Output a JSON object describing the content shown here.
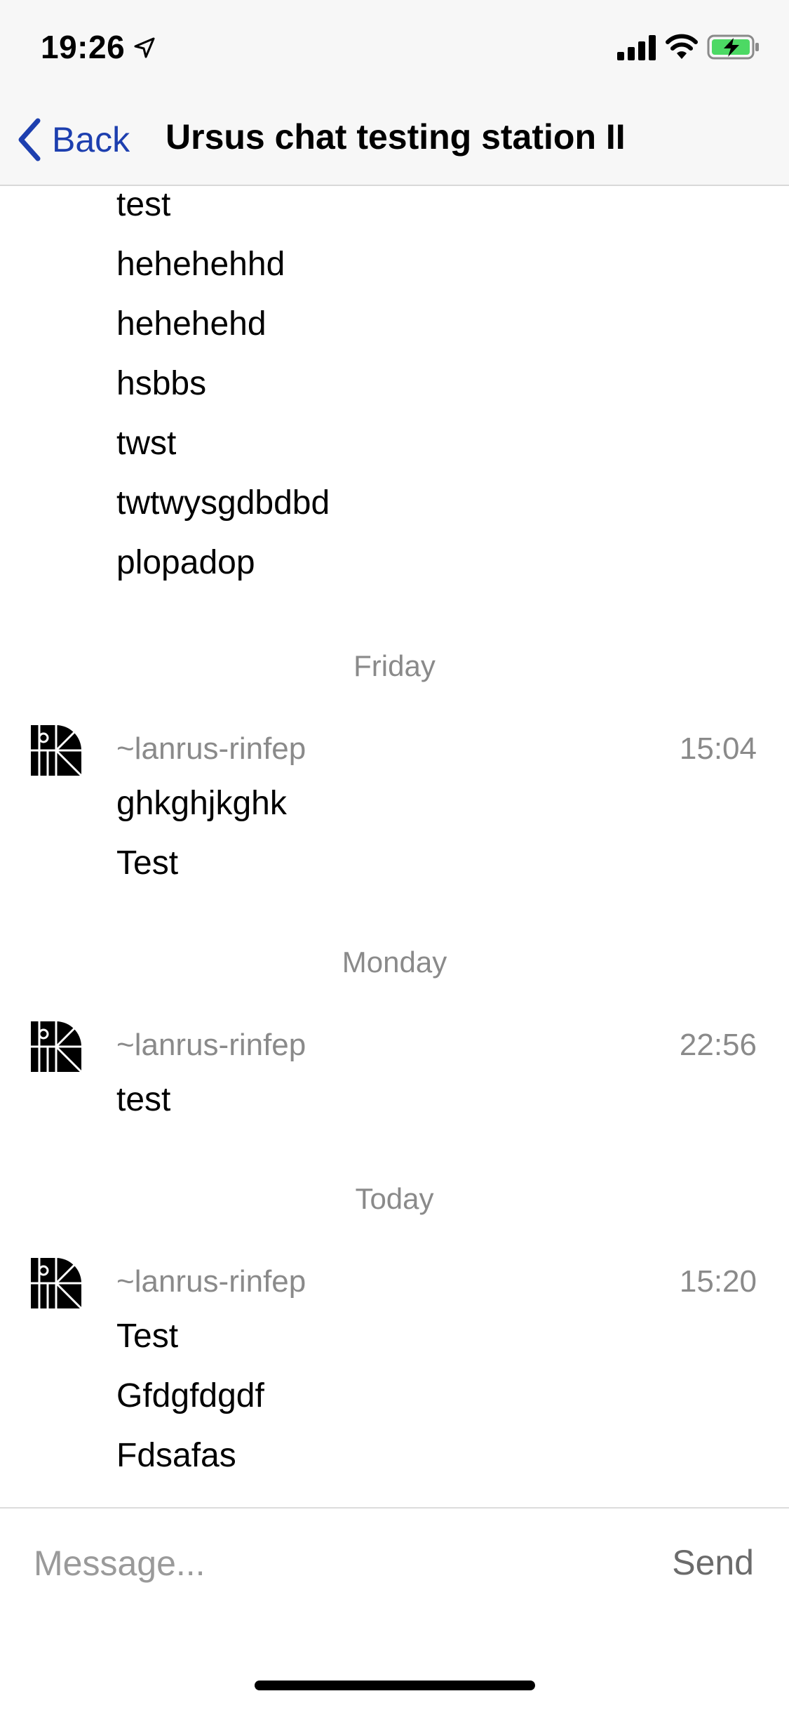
{
  "status_bar": {
    "time": "19:26",
    "icons": [
      "location-arrow-icon",
      "cellular-signal-icon",
      "wifi-icon",
      "battery-charging-icon"
    ],
    "battery_color": "#4cd964"
  },
  "nav": {
    "back_label": "Back",
    "title": "Ursus chat testing station II",
    "accent_color": "#1d3faf"
  },
  "earlier_messages": [
    "test",
    "hehehehhd",
    "hehehehd",
    "hsbbs",
    "twst",
    "twtwysgdbdbd",
    "plopadop"
  ],
  "days": [
    {
      "label": "Friday",
      "author": "~lanrus-rinfep",
      "time": "15:04",
      "messages": [
        "ghkghjkghk",
        "Test"
      ]
    },
    {
      "label": "Monday",
      "author": "~lanrus-rinfep",
      "time": "22:56",
      "messages": [
        "test"
      ]
    },
    {
      "label": "Today",
      "author": "~lanrus-rinfep",
      "time": "15:20",
      "messages": [
        "Test",
        "Gfdgfdgdf",
        "Fdsafas"
      ]
    }
  ],
  "composer": {
    "placeholder": "Message...",
    "value": "",
    "send_label": "Send"
  }
}
